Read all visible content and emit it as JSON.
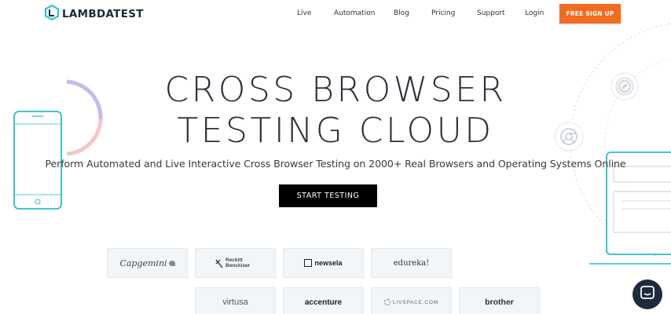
{
  "header": {
    "logo_text": "LAMBDATEST",
    "nav": [
      "Live",
      "Automation",
      "Blog",
      "Pricing",
      "Support",
      "Login"
    ],
    "signup_label": "FREE SIGN UP"
  },
  "hero": {
    "title_line1": "CROSS BROWSER",
    "title_line2": "TESTING CLOUD",
    "subtitle": "Perform Automated and Live Interactive Cross Browser Testing on 2000+ Real Browsers and Operating Systems Online",
    "cta_label": "START TESTING"
  },
  "clients": {
    "row1": [
      "Capgemini",
      "Reckitt Benckiser",
      "newsela",
      "edureka!"
    ],
    "row2": [
      "virtusa",
      "accenture",
      "LIVSPACE.COM",
      "brother"
    ]
  },
  "colors": {
    "accent_orange": "#f26b21",
    "teal": "#27bfc6",
    "dark": "#1e2b3c"
  },
  "icons": {
    "logo": "lambdatest-logo-icon",
    "chat": "chat-icon",
    "chrome": "chrome-icon",
    "safari": "safari-icon"
  }
}
